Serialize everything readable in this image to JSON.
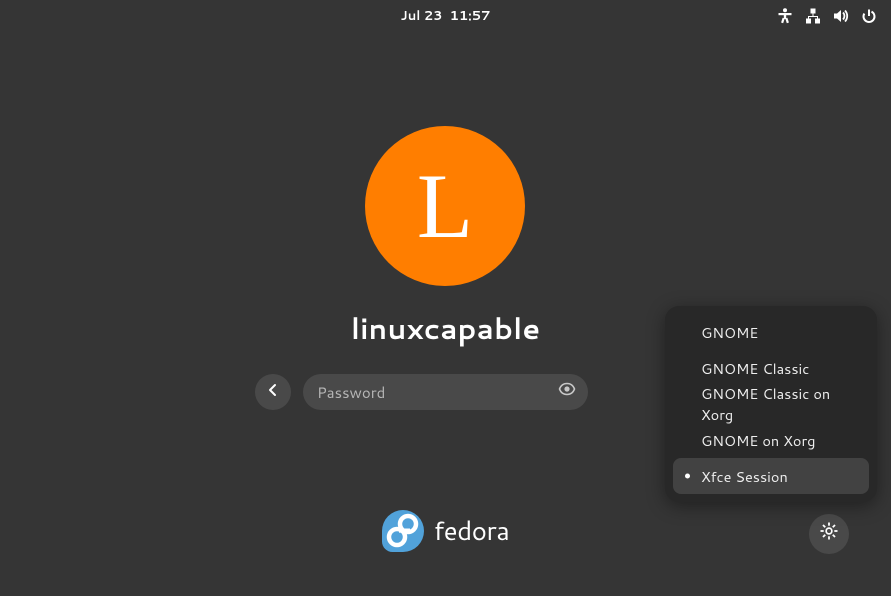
{
  "topbar": {
    "date": "Jul 23",
    "time": "11:57"
  },
  "user": {
    "initial": "L",
    "name": "linuxcapable"
  },
  "password": {
    "placeholder": "Password",
    "value": ""
  },
  "sessions": {
    "items": [
      {
        "label": "GNOME"
      },
      {
        "label": "GNOME Classic"
      },
      {
        "label": "GNOME Classic on Xorg"
      },
      {
        "label": "GNOME on Xorg"
      },
      {
        "label": "Xfce Session"
      }
    ],
    "selected_index": 4
  },
  "branding": {
    "name": "fedora"
  },
  "colors": {
    "background": "#353535",
    "avatar": "#ff7e00",
    "menu_bg": "#282828",
    "menu_selected": "#424242",
    "fedora_blue": "#51a2da"
  }
}
